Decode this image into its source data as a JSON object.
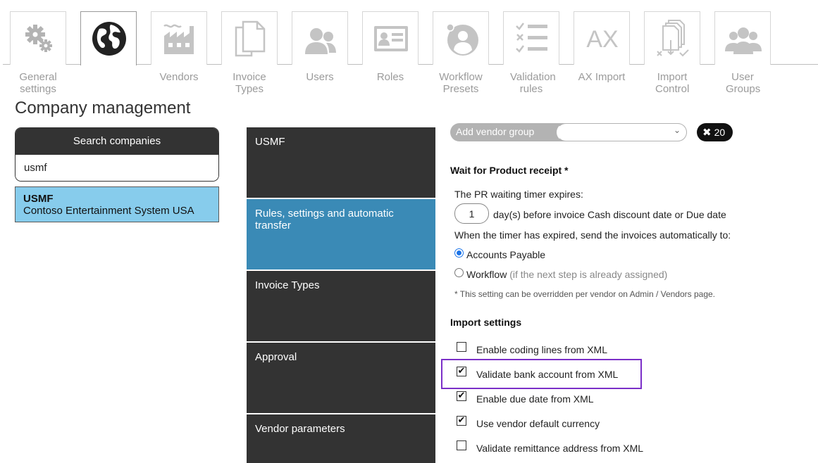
{
  "nav": {
    "tabs": [
      {
        "label": "General settings",
        "icon": "gears-icon"
      },
      {
        "label": "",
        "icon": "globe-icon"
      },
      {
        "label": "Vendors",
        "icon": "factory-icon"
      },
      {
        "label": "Invoice Types",
        "icon": "documents-icon"
      },
      {
        "label": "Users",
        "icon": "users-icon"
      },
      {
        "label": "Roles",
        "icon": "id-card-icon"
      },
      {
        "label": "Workflow Presets",
        "icon": "user-circle-icon"
      },
      {
        "label": "Validation rules",
        "icon": "checklist-icon"
      },
      {
        "label": "AX Import",
        "icon": "ax-icon"
      },
      {
        "label": "Import Control",
        "icon": "import-control-icon"
      },
      {
        "label": "User Groups",
        "icon": "user-groups-icon"
      }
    ],
    "ax_text": "AX"
  },
  "page": {
    "title": "Company management"
  },
  "search": {
    "header": "Search companies",
    "value": "usmf"
  },
  "company": {
    "code": "USMF",
    "name": "Contoso Entertainment System USA"
  },
  "menu": [
    {
      "label": "USMF"
    },
    {
      "label": "Rules, settings and automatic transfer"
    },
    {
      "label": "Invoice Types"
    },
    {
      "label": "Approval"
    },
    {
      "label": "Vendor parameters"
    }
  ],
  "vendor_group": {
    "label": "Add vendor group",
    "count": "20"
  },
  "wait_pr": {
    "heading": "Wait for Product receipt *",
    "timer_text": "The PR waiting timer expires:",
    "days_value": "1",
    "days_text": "day(s) before invoice Cash discount date or Due date",
    "expired_text": "When the timer has expired, send the invoices automatically to:",
    "option_ap": "Accounts Payable",
    "option_wf": "Workflow",
    "option_wf_hint": "(if the next step is already assigned)",
    "note": "* This setting can be overridden per vendor on Admin / Vendors page."
  },
  "import_settings": {
    "heading": "Import settings",
    "items": [
      {
        "label": "Enable coding lines from XML",
        "checked": false
      },
      {
        "label": "Validate bank account from XML",
        "checked": true
      },
      {
        "label": "Enable due date from XML",
        "checked": true
      },
      {
        "label": "Use vendor default currency",
        "checked": true
      },
      {
        "label": "Validate remittance address from XML",
        "checked": false
      }
    ]
  },
  "colors": {
    "accent": "#3a8ab6",
    "selected_company": "#87ccec",
    "dark": "#333333",
    "highlight": "#7b2fc8"
  }
}
